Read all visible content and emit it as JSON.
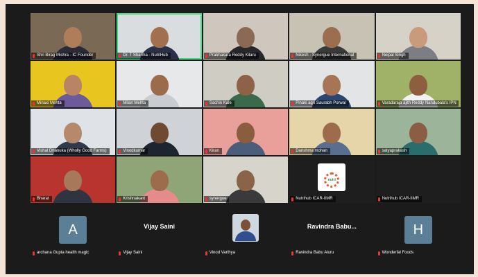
{
  "participants": [
    {
      "name": "Shri Birag Mishra - IC Founder",
      "bg": "#7a6a55",
      "skin": "#b07d5a",
      "shirt": "#2b2b38"
    },
    {
      "name": "Dr. T Sharma - NutriHub",
      "bg": "#d9dde0",
      "skin": "#a2704f",
      "shirt": "#2a3147",
      "active": true
    },
    {
      "name": "Prabhakara Reddy Kilaru",
      "bg": "#cfc7be",
      "skin": "#8a6a55",
      "shirt": "#27272b"
    },
    {
      "name": "Nikesh - Synergue International",
      "bg": "#c8c2b5",
      "skin": "#9a6e4e",
      "shirt": "#3a3a3a"
    },
    {
      "name": "Neipal Singh",
      "bg": "#d7d2c7",
      "skin": "#c99a7c",
      "shirt": "#7b7f85"
    },
    {
      "name": "Minaxi Mehta",
      "bg": "#e9c61f",
      "skin": "#b98465",
      "shirt": "#6d5a9a"
    },
    {
      "name": "Milan Mehta",
      "bg": "#e7e8ea",
      "skin": "#9c6b4c",
      "shirt": "#c9cdd2"
    },
    {
      "name": "Sachin Kale",
      "bg": "#cfccc4",
      "skin": "#8d6248",
      "shirt": "#3a6a4a"
    },
    {
      "name": "Pinaki agri Saurabh Porwal",
      "bg": "#e3e4e6",
      "skin": "#a77555",
      "shirt": "#2c4672"
    },
    {
      "name": "Varadaraja ajith Reddy Nandubala's IPN",
      "bg": "#9fb268",
      "skin": "#8d5e40",
      "shirt": "#f2f2f2"
    },
    {
      "name": "Vishal Dhanuka (Wholly Good Farms)",
      "bg": "#dfe2e6",
      "skin": "#b58a6a",
      "shirt": "#2f3a4a"
    },
    {
      "name": "Vinodkumar",
      "bg": "#cfd2d6",
      "skin": "#6f4a33",
      "shirt": "#1d2530"
    },
    {
      "name": "Kiran",
      "bg": "#e9a09b",
      "skin": "#8a5c40",
      "shirt": "#4a5d7a"
    },
    {
      "name": "Darishma mohan",
      "bg": "#e5d5a8",
      "skin": "#9c6c4c",
      "shirt": "#5a6f8f"
    },
    {
      "name": "satyaprakash",
      "bg": "#9bb49a",
      "skin": "#8a5e44",
      "shirt": "#2a6d6d"
    },
    {
      "name": "Bharat",
      "bg": "#b8342e",
      "skin": "#a8785a",
      "shirt": "#2f3540"
    },
    {
      "name": "Krishnakant",
      "bg": "#8fa477",
      "skin": "#9c6c4c",
      "shirt": "#e58b8b"
    },
    {
      "name": "synergue",
      "bg": "#d7d4cc",
      "skin": "#8a6449",
      "shirt": "#3a3a3a"
    },
    {
      "name": "Nutrihub ICAR-IIMR",
      "logo": true,
      "logo_text": "nutri"
    },
    {
      "name": "Nutrihub ICAR-IIMR",
      "empty": true
    }
  ],
  "bottom": [
    {
      "type": "letter",
      "letter": "A",
      "name": "archana Gupta health magic"
    },
    {
      "type": "name",
      "display": "Vijay Saini",
      "name": "Vijay Saini"
    },
    {
      "type": "photo",
      "name": "Vinod Varthya"
    },
    {
      "type": "name",
      "display": "Ravindra  Babu...",
      "name": "Ravindra Babu Aluru"
    },
    {
      "type": "letter",
      "letter": "H",
      "name": "Wonderfal Foods"
    }
  ]
}
